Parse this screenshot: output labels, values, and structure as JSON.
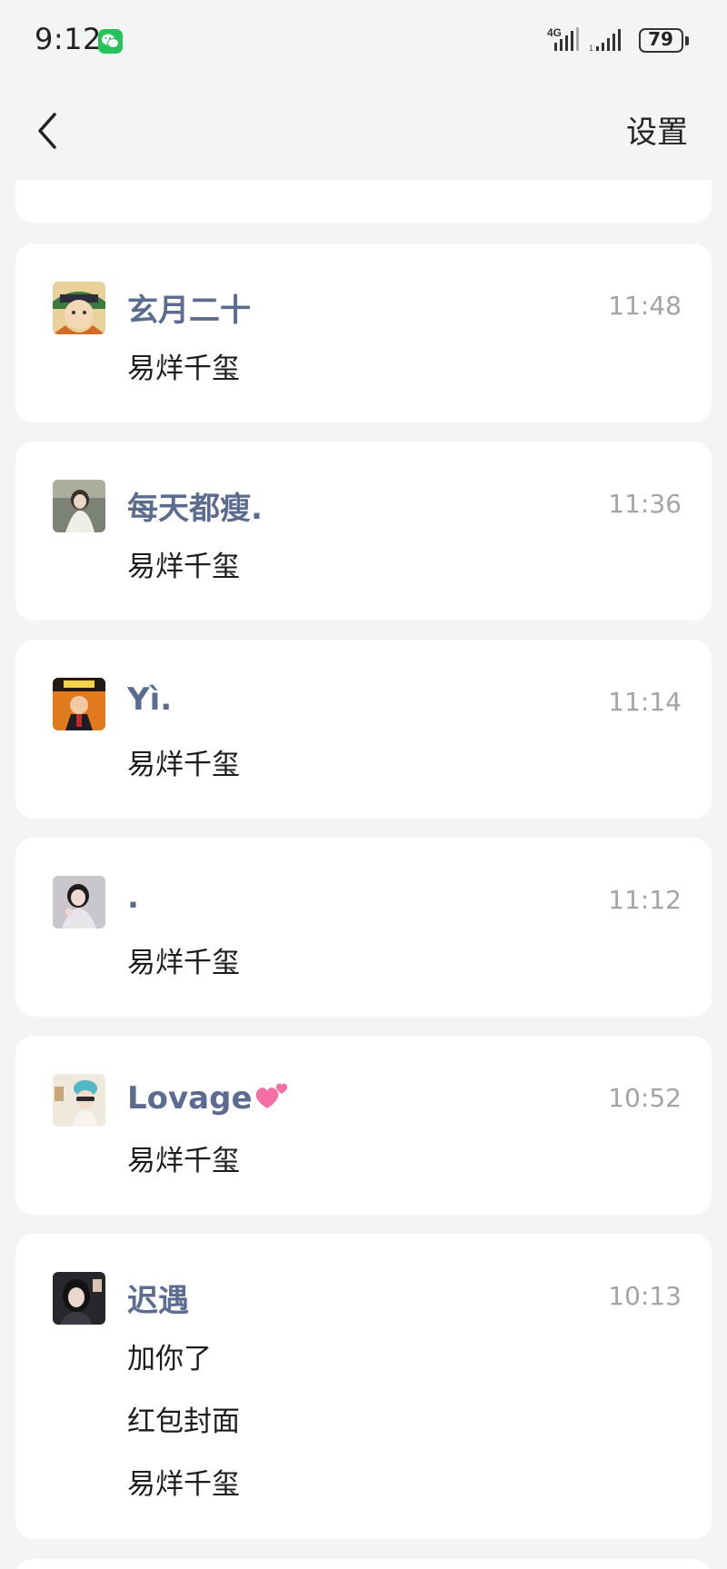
{
  "status_bar": {
    "time": "9:12",
    "battery": "79",
    "network": "4G",
    "app_icon": "wechat-icon"
  },
  "nav": {
    "back_icon": "chevron-left-icon",
    "settings_label": "设置"
  },
  "colors": {
    "page_bg": "#f3f4f4",
    "card_bg": "#ffffff",
    "name_color": "#5b6c90",
    "time_color": "#a4a4a4",
    "wechat_green": "#25c35a"
  },
  "cards": [
    {
      "name": "玄月二十",
      "time": "11:48",
      "lines": [
        "易烊千玺"
      ]
    },
    {
      "name": "每天都瘦.",
      "time": "11:36",
      "lines": [
        "易烊千玺"
      ]
    },
    {
      "name": "Yì.",
      "time": "11:14",
      "lines": [
        "易烊千玺"
      ]
    },
    {
      "name": ".",
      "time": "11:12",
      "lines": [
        "易烊千玺"
      ]
    },
    {
      "name": "Lovage",
      "name_emoji": "two-hearts-icon",
      "time": "10:52",
      "lines": [
        "易烊千玺"
      ]
    },
    {
      "name": "迟遇",
      "time": "10:13",
      "lines": [
        "加你了",
        "红包封面",
        "易烊千玺"
      ]
    }
  ]
}
